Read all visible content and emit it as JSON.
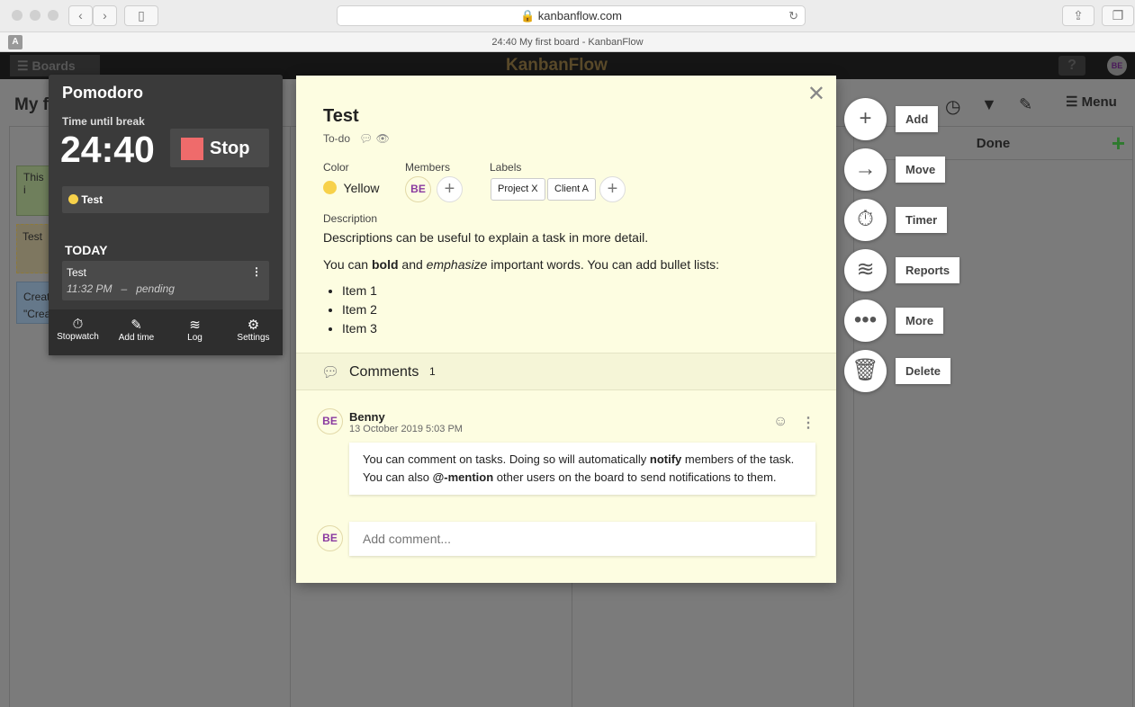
{
  "browser": {
    "url": "kanbanflow.com",
    "tab_title": "24:40 My first board - KanbanFlow",
    "tab_icon": "A"
  },
  "app": {
    "boards_label": "Boards",
    "logo": "KanbanFlow",
    "help": "?",
    "user_initials": "BE",
    "board_title": "My f",
    "menu_label": "Menu",
    "done_column": "Done"
  },
  "board_cards": [
    "This i",
    "Test",
    "Creat",
    "\"Crea"
  ],
  "pomodoro": {
    "title": "Pomodoro",
    "subtitle": "Time until break",
    "time": "24:40",
    "stop_label": "Stop",
    "current_task": "Test",
    "today_label": "TODAY",
    "log_entry": {
      "task": "Test",
      "start": "11:32 PM",
      "separator": "–",
      "status": "pending"
    },
    "footer": [
      {
        "label": "Stopwatch",
        "icon": "stopwatch-icon"
      },
      {
        "label": "Add time",
        "icon": "edit-icon"
      },
      {
        "label": "Log",
        "icon": "layers-icon"
      },
      {
        "label": "Settings",
        "icon": "gear-icon"
      }
    ]
  },
  "task": {
    "title": "Test",
    "column": "To-do",
    "color_label": "Color",
    "color": "Yellow",
    "color_hex": "#f7d14a",
    "members_label": "Members",
    "member": "BE",
    "labels_label": "Labels",
    "labels": [
      "Project X",
      "Client A"
    ],
    "description_label": "Description",
    "desc_line1": "Descriptions can be useful to explain a task in more detail.",
    "desc_line2": {
      "a": "You can ",
      "b": "bold",
      "c": " and ",
      "d": "emphasize",
      "e": " important words. You can add bullet lists:"
    },
    "bullets": [
      "Item 1",
      "Item 2",
      "Item 3"
    ],
    "comments_label": "Comments",
    "comments_count": "1",
    "comment": {
      "initials": "BE",
      "author": "Benny",
      "date": "13 October 2019 5:03 PM",
      "l1a": "You can comment on tasks. Doing so will automatically ",
      "l1b": "notify",
      "l1c": " members of the task.",
      "l2a": "You can also ",
      "l2b": "@-mention",
      "l2c": " other users on the board to send notifications to them."
    },
    "add_comment_placeholder": "Add comment..."
  },
  "actions": [
    {
      "label": "Add",
      "icon": "plus-icon"
    },
    {
      "label": "Move",
      "icon": "arrow-right-icon"
    },
    {
      "label": "Timer",
      "icon": "stopwatch-icon"
    },
    {
      "label": "Reports",
      "icon": "layers-icon"
    },
    {
      "label": "More",
      "icon": "more-icon"
    },
    {
      "label": "Delete",
      "icon": "trash-icon"
    }
  ]
}
